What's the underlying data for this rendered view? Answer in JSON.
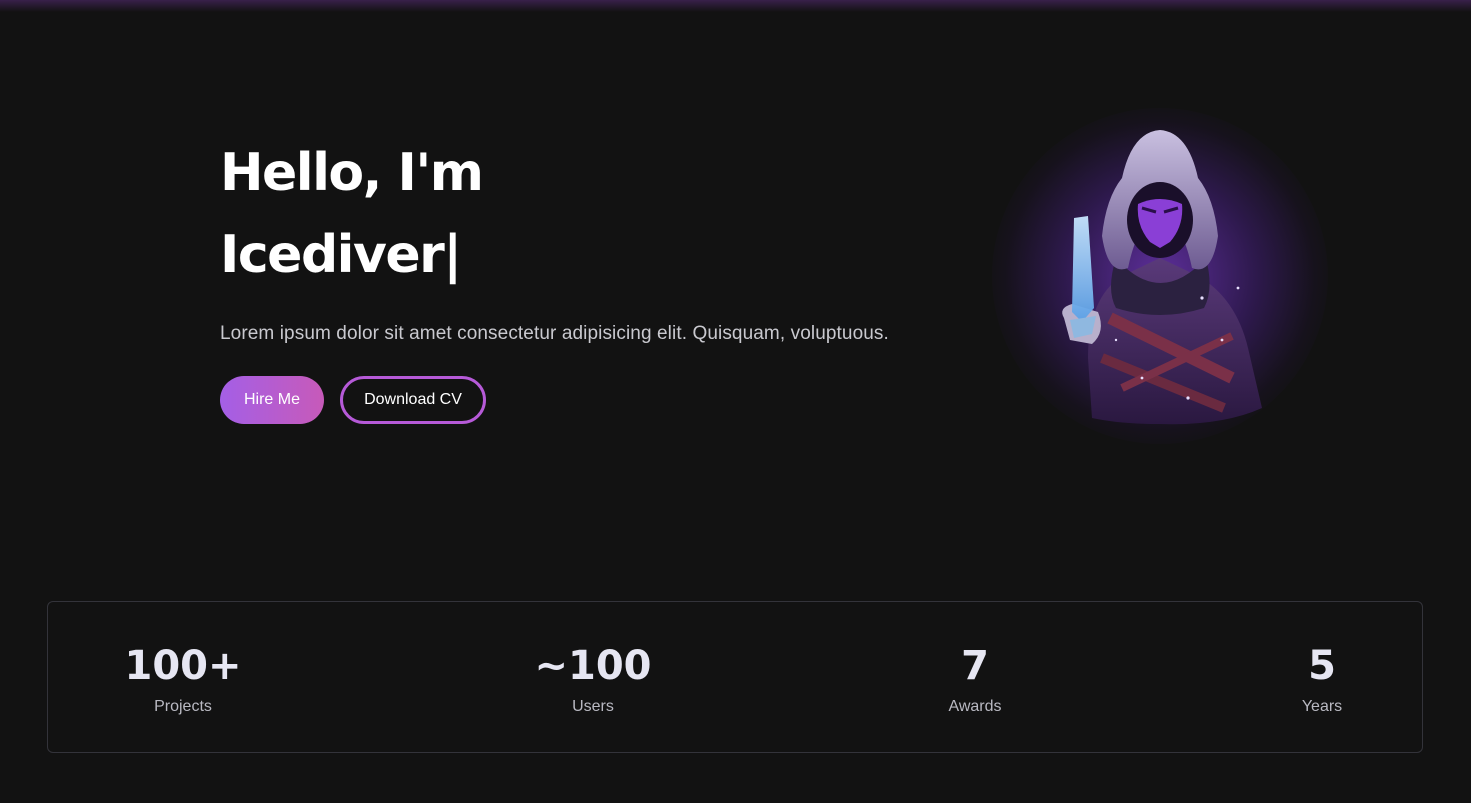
{
  "hero": {
    "greeting": "Hello, I'm",
    "name": "Icediver",
    "cursor": "|",
    "subtitle": "Lorem ipsum dolor sit amet consectetur adipisicing elit. Quisquam, voluptuous.",
    "buttons": {
      "hire_label": "Hire Me",
      "cv_label": "Download CV"
    },
    "avatar_icon": "hooded-ninja-avatar"
  },
  "stats": [
    {
      "value": "100+",
      "label": "Projects"
    },
    {
      "value": "~100",
      "label": "Users"
    },
    {
      "value": "7",
      "label": "Awards"
    },
    {
      "value": "5",
      "label": "Years"
    }
  ],
  "colors": {
    "background": "#121212",
    "accent_start": "#a45fe6",
    "accent_end": "#c75ab9",
    "outline": "#b65ad8",
    "stat_value": "#e6e6f2",
    "muted_text": "#b9b9c2"
  }
}
